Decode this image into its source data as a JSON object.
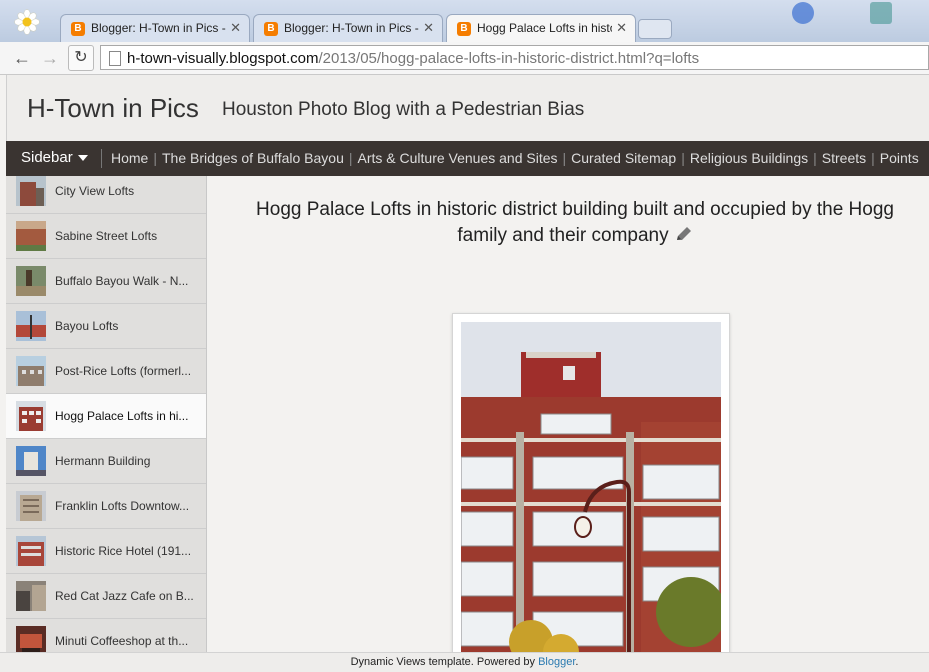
{
  "browser": {
    "tabs": [
      {
        "title": "Blogger: H-Town in Pics -",
        "active": false
      },
      {
        "title": "Blogger: H-Town in Pics -",
        "active": false
      },
      {
        "title": "Hogg Palace Lofts in histo",
        "active": true
      }
    ],
    "url_host": "h-town-visually.blogspot.com",
    "url_path": "/2013/05/hogg-palace-lofts-in-historic-district.html?q=lofts"
  },
  "blog": {
    "title": "H-Town in Pics",
    "description": "Houston Photo Blog with a Pedestrian Bias"
  },
  "nav": {
    "sidebar_label": "Sidebar",
    "links": [
      "Home",
      "The Bridges of Buffalo Bayou",
      "Arts & Culture Venues and Sites",
      "Curated Sitemap",
      "Religious Buildings",
      "Streets",
      "Points"
    ]
  },
  "sidebar": {
    "items": [
      {
        "label": "City View Lofts",
        "active": false
      },
      {
        "label": "Sabine Street Lofts",
        "active": false
      },
      {
        "label": "Buffalo Bayou Walk - N...",
        "active": false
      },
      {
        "label": "Bayou Lofts",
        "active": false
      },
      {
        "label": "Post-Rice Lofts (formerl...",
        "active": false
      },
      {
        "label": "Hogg Palace Lofts in hi...",
        "active": true
      },
      {
        "label": "Hermann Building",
        "active": false
      },
      {
        "label": "Franklin Lofts Downtow...",
        "active": false
      },
      {
        "label": "Historic Rice Hotel (191...",
        "active": false
      },
      {
        "label": "Red Cat Jazz Cafe on B...",
        "active": false
      },
      {
        "label": "Minuti Coffeeshop at th...",
        "active": false
      }
    ]
  },
  "post": {
    "title": "Hogg Palace Lofts in historic district building built and occupied by the Hogg family and their company"
  },
  "footer": {
    "text": "Dynamic Views template. Powered by ",
    "link": "Blogger",
    "end": "."
  },
  "icons": {
    "edit": "pencil-icon",
    "back": "back-arrow-icon",
    "forward": "forward-arrow-icon",
    "reload": "reload-icon",
    "favicon": "blogger-favicon-icon"
  }
}
